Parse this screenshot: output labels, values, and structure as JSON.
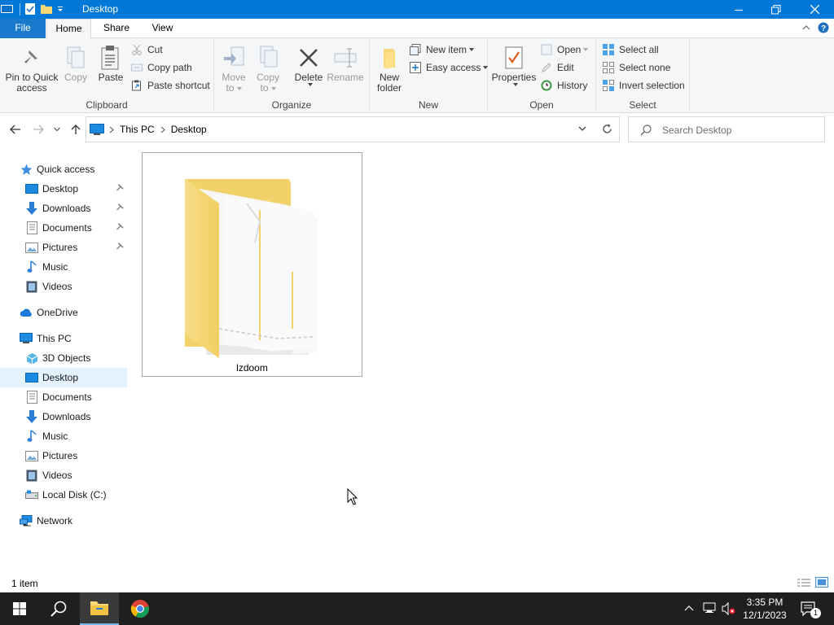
{
  "window": {
    "title": "Desktop",
    "accent_color": "#0078d7"
  },
  "titlebar": {
    "quick_icons": [
      "explorer-app-icon",
      "properties-check-icon",
      "new-folder-icon",
      "customize-dropdown-icon"
    ],
    "controls": [
      "minimize-icon",
      "maximize-icon",
      "close-icon"
    ]
  },
  "ribbon_tabs": {
    "file": "File",
    "home": "Home",
    "share": "Share",
    "view": "View"
  },
  "ribbon": {
    "clipboard": {
      "label": "Clipboard",
      "pin_line1": "Pin to Quick",
      "pin_line2": "access",
      "copy": "Copy",
      "paste": "Paste",
      "cut": "Cut",
      "copy_path": "Copy path",
      "paste_shortcut": "Paste shortcut"
    },
    "organize": {
      "label": "Organize",
      "move_line1": "Move",
      "move_line2": "to",
      "copy_line1": "Copy",
      "copy_line2": "to",
      "delete": "Delete",
      "rename": "Rename"
    },
    "new": {
      "label": "New",
      "new_folder_line1": "New",
      "new_folder_line2": "folder",
      "new_item": "New item",
      "easy_access": "Easy access"
    },
    "open": {
      "label": "Open",
      "properties": "Properties",
      "open": "Open",
      "edit": "Edit",
      "history": "History"
    },
    "select": {
      "label": "Select",
      "select_all": "Select all",
      "select_none": "Select none",
      "invert_selection": "Invert selection"
    }
  },
  "address": {
    "crumbs": [
      "This PC",
      "Desktop"
    ]
  },
  "search": {
    "placeholder": "Search Desktop"
  },
  "nav": {
    "quick_access": {
      "label": "Quick access",
      "items": [
        {
          "label": "Desktop",
          "icon": "desktop-icon",
          "pinned": true
        },
        {
          "label": "Downloads",
          "icon": "downloads-icon",
          "pinned": true
        },
        {
          "label": "Documents",
          "icon": "documents-icon",
          "pinned": true
        },
        {
          "label": "Pictures",
          "icon": "pictures-icon",
          "pinned": true
        },
        {
          "label": "Music",
          "icon": "music-icon",
          "pinned": false
        },
        {
          "label": "Videos",
          "icon": "videos-icon",
          "pinned": false
        }
      ]
    },
    "onedrive": "OneDrive",
    "this_pc": {
      "label": "This PC",
      "items": [
        {
          "label": "3D Objects",
          "icon": "3d-objects-icon"
        },
        {
          "label": "Desktop",
          "icon": "desktop-icon",
          "selected": true
        },
        {
          "label": "Documents",
          "icon": "documents-icon"
        },
        {
          "label": "Downloads",
          "icon": "downloads-icon"
        },
        {
          "label": "Music",
          "icon": "music-icon"
        },
        {
          "label": "Pictures",
          "icon": "pictures-icon"
        },
        {
          "label": "Videos",
          "icon": "videos-icon"
        },
        {
          "label": "Local Disk (C:)",
          "icon": "local-disk-icon"
        }
      ]
    },
    "network": "Network"
  },
  "files": [
    {
      "name": "lzdoom",
      "type": "folder",
      "icon": "folder-icon"
    }
  ],
  "status": {
    "count": "1 item"
  },
  "taskbar": {
    "apps": [
      "start-icon",
      "search-icon",
      "file-explorer-icon",
      "chrome-icon"
    ],
    "active_app": "file-explorer-icon",
    "tray_icons": [
      "show-hidden-icons-chevron",
      "network-icon",
      "volume-muted-icon"
    ],
    "time": "3:35 PM",
    "date": "12/1/2023",
    "notifications": "1"
  }
}
